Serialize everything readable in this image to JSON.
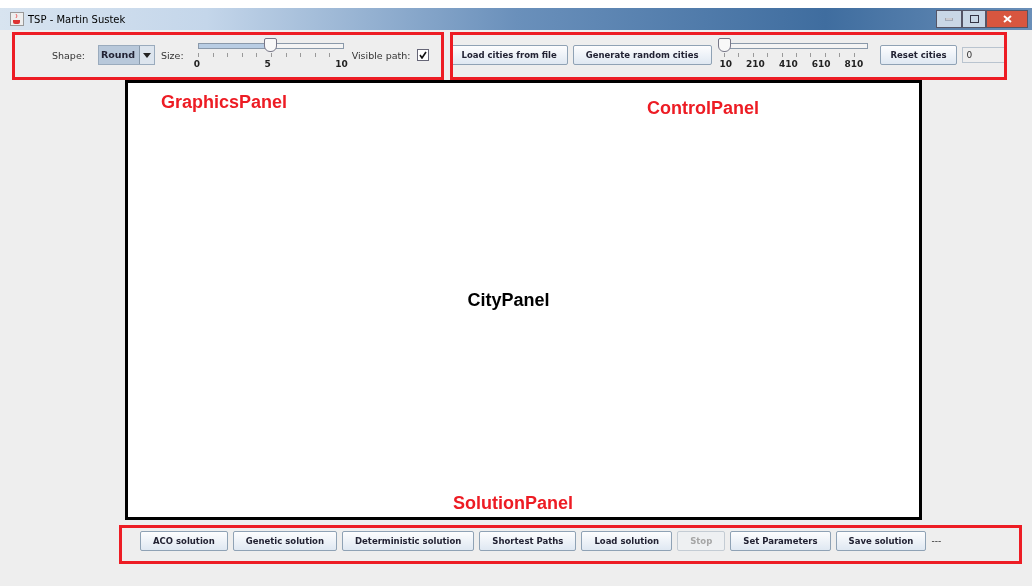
{
  "window": {
    "title": "TSP - Martin Sustek"
  },
  "graphics_panel": {
    "shape_label": "Shape:",
    "shape_value": "Round",
    "size_label": "Size:",
    "size_slider": {
      "level": 0.5,
      "ticks": [
        "0",
        "5",
        "10"
      ]
    },
    "visible_path_label": "Visible path:",
    "visible_path": {
      "checked": true
    }
  },
  "control_panel": {
    "buttons": [
      {
        "label": "Load cities from file",
        "disabled": false
      },
      {
        "label": "Generate random cities",
        "disabled": false
      }
    ],
    "cities_slider": {
      "level": 0,
      "ticks": [
        "10",
        "210",
        "410",
        "610",
        "810"
      ]
    },
    "reset_button": "Reset cities",
    "count_field": "0"
  },
  "city_panel": {
    "label": "CityPanel"
  },
  "solution_panel": {
    "buttons": [
      {
        "label": "ACO solution",
        "disabled": false
      },
      {
        "label": "Genetic solution",
        "disabled": false
      },
      {
        "label": "Deterministic solution",
        "disabled": false
      },
      {
        "label": "Shortest Paths",
        "disabled": false
      },
      {
        "label": "Load solution",
        "disabled": false
      },
      {
        "label": "Stop",
        "disabled": true
      },
      {
        "label": "Set Parameters",
        "disabled": false
      },
      {
        "label": "Save solution",
        "disabled": false
      }
    ],
    "status": "---"
  },
  "annotations": [
    {
      "kind": "graphics",
      "label": "GraphicsPanel"
    },
    {
      "kind": "control",
      "label": "ControlPanel"
    },
    {
      "kind": "solution",
      "label": "SolutionPanel"
    }
  ]
}
